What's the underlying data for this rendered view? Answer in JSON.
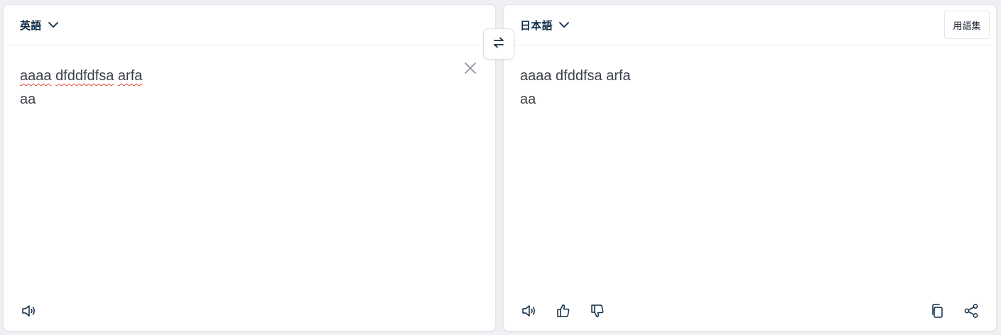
{
  "source": {
    "language": "英語",
    "words_line1": [
      "aaaa",
      "dfddfdfsa",
      "arfa"
    ],
    "line2": "aa"
  },
  "target": {
    "language": "日本語",
    "line1": "aaaa dfddfsa arfa",
    "line2": "aa",
    "glossary_label": "用語集"
  },
  "icons": {
    "swap": "swap-arrows-icon",
    "clear": "close-icon",
    "speaker": "speaker-icon",
    "like": "thumbs-up-icon",
    "dislike": "thumbs-down-icon",
    "copy": "copy-icon",
    "share": "share-icon",
    "dropdown": "chevron-down-icon"
  },
  "colors": {
    "header_text": "#0f2b46",
    "body_text": "#3a3f47",
    "spellcheck": "#e0473d"
  }
}
